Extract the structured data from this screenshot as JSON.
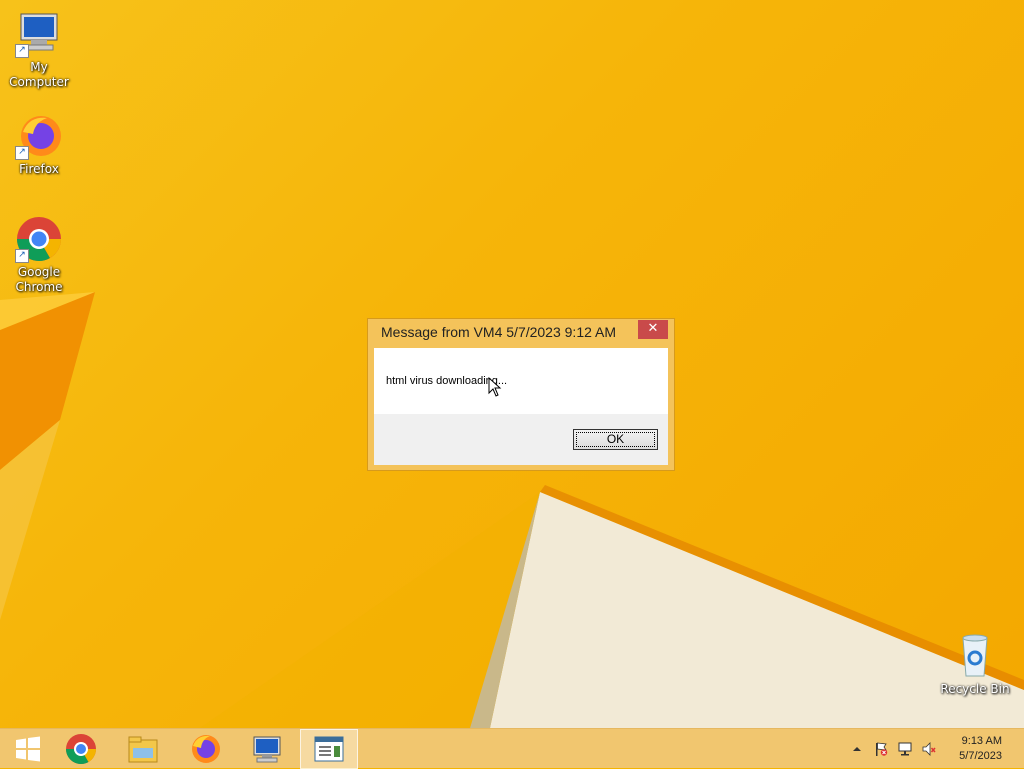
{
  "desktop": {
    "icons": [
      {
        "label": "My Computer",
        "icon": "my-computer-icon"
      },
      {
        "label": "Firefox",
        "icon": "firefox-icon"
      },
      {
        "label": "Google Chrome",
        "icon": "chrome-icon"
      },
      {
        "label": "Recycle Bin",
        "icon": "recycle-bin-icon"
      }
    ]
  },
  "dialog": {
    "title": "Message from VM4 5/7/2023 9:12 AM",
    "message": "html virus downloading...",
    "ok_label": "OK",
    "close_glyph": "✕"
  },
  "taskbar": {
    "buttons": [
      {
        "icon": "windows-start-icon"
      },
      {
        "icon": "chrome-icon"
      },
      {
        "icon": "file-explorer-icon"
      },
      {
        "icon": "firefox-icon"
      },
      {
        "icon": "remote-desktop-icon"
      },
      {
        "icon": "message-window-icon"
      }
    ],
    "clock_time": "9:13 AM",
    "clock_date": "5/7/2023"
  },
  "colors": {
    "wallpaper": "#f5b400",
    "dialog_frame": "#f4c35a",
    "close_button": "#c94a4a"
  }
}
